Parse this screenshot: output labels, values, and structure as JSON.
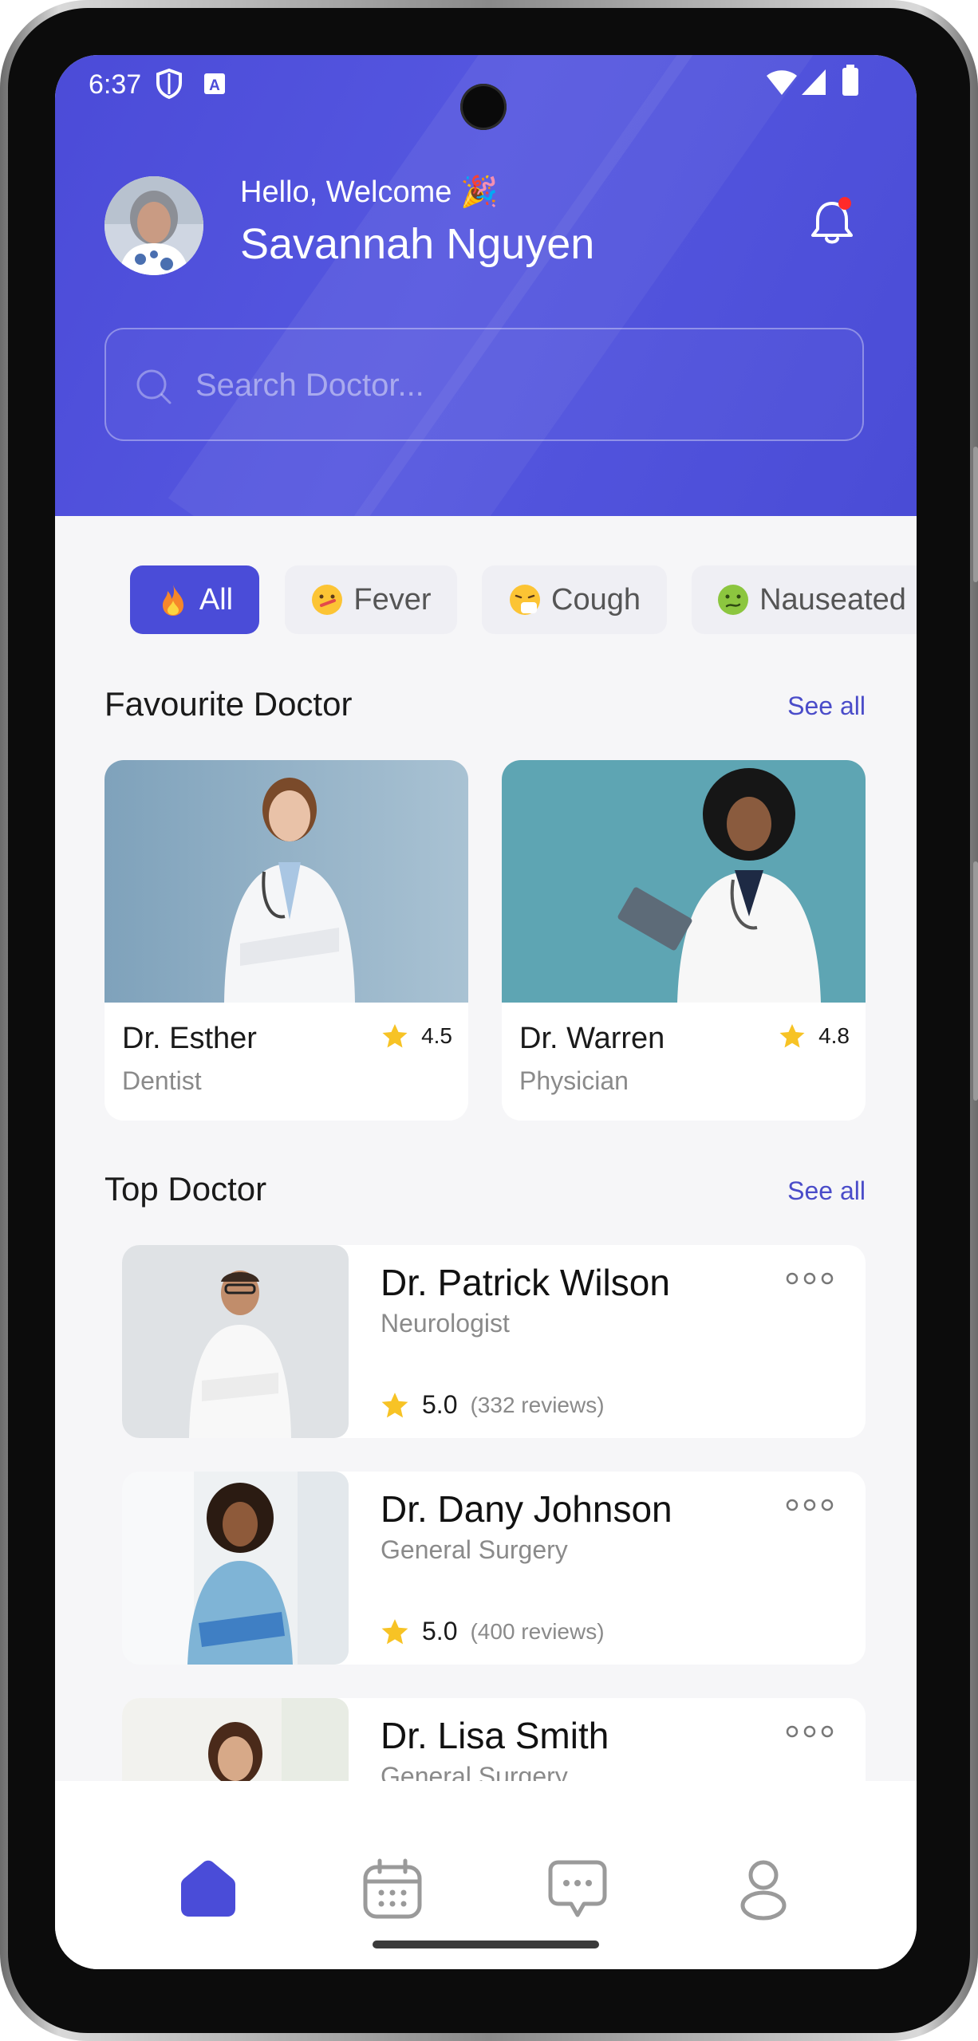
{
  "status_bar": {
    "time": "6:37"
  },
  "header": {
    "greeting": "Hello, Welcome 🎉",
    "user_name": "Savannah Nguyen",
    "search_placeholder": "Search Doctor..."
  },
  "categories": [
    {
      "label": "All",
      "emoji": "fire",
      "active": true
    },
    {
      "label": "Fever",
      "emoji": "face-with-thermometer",
      "active": false
    },
    {
      "label": "Cough",
      "emoji": "sneezing-face",
      "active": false
    },
    {
      "label": "Nauseated",
      "emoji": "nauseated-face",
      "active": false
    }
  ],
  "favourite": {
    "title": "Favourite Doctor",
    "see_all": "See all",
    "doctors": [
      {
        "name": "Dr. Esther",
        "specialty": "Dentist",
        "rating": "4.5"
      },
      {
        "name": "Dr. Warren",
        "specialty": "Physician",
        "rating": "4.8"
      }
    ]
  },
  "top": {
    "title": "Top Doctor",
    "see_all": "See all",
    "doctors": [
      {
        "name": "Dr. Patrick Wilson",
        "specialty": "Neurologist",
        "rating": "5.0",
        "reviews": "(332 reviews)"
      },
      {
        "name": "Dr. Dany Johnson",
        "specialty": "General Surgery",
        "rating": "5.0",
        "reviews": "(400 reviews)"
      },
      {
        "name": "Dr. Lisa Smith",
        "specialty": "General Surgery",
        "rating": "",
        "reviews": ""
      }
    ]
  },
  "nav": [
    {
      "icon": "home-icon",
      "active": true
    },
    {
      "icon": "calendar-icon",
      "active": false
    },
    {
      "icon": "chat-icon",
      "active": false
    },
    {
      "icon": "profile-icon",
      "active": false
    }
  ],
  "colors": {
    "primary": "#4A4CD8",
    "background": "#F6F6F8",
    "star": "#F7C325"
  }
}
